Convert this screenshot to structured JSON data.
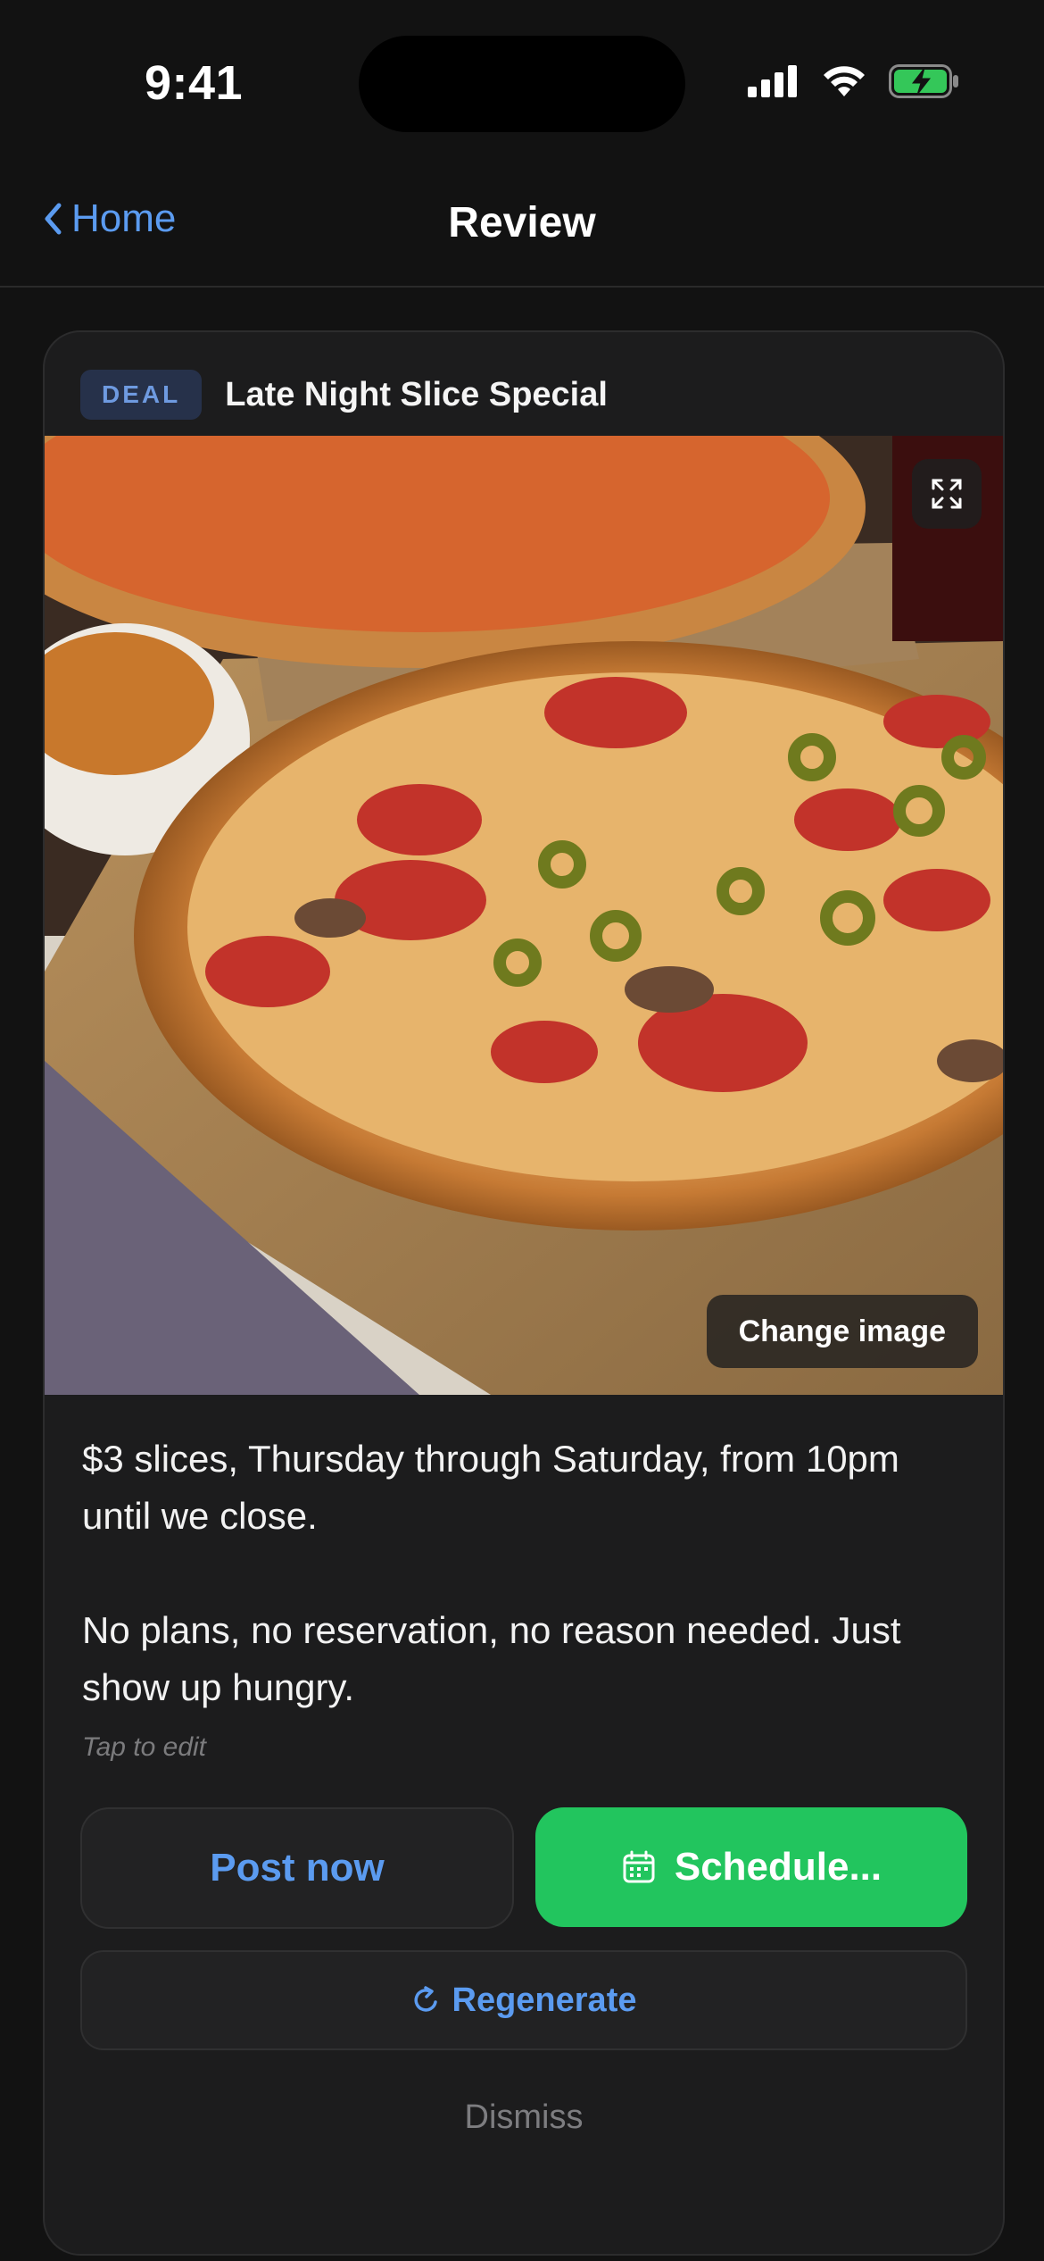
{
  "status_bar": {
    "time": "9:41",
    "icons": [
      "cellular-signal-icon",
      "wifi-icon",
      "battery-charging-icon"
    ]
  },
  "nav": {
    "back_label": "Home",
    "title": "Review"
  },
  "card": {
    "badge": "DEAL",
    "title": "Late Night Slice Special",
    "image": {
      "description_icon": "pizza-photo",
      "change_label": "Change image",
      "expand_icon": "expand-icon"
    },
    "body": "$3 slices, Thursday through Saturday, from 10pm until we close.\n\nNo plans, no reservation, no reason needed. Just show up hungry.",
    "hint": "Tap to edit",
    "actions": {
      "post_now": "Post now",
      "schedule": "Schedule...",
      "regenerate": "Regenerate",
      "dismiss": "Dismiss"
    }
  },
  "colors": {
    "accent_blue": "#5b9bf0",
    "schedule_green": "#22c55e",
    "background": "#121212",
    "card": "#1c1c1d"
  }
}
